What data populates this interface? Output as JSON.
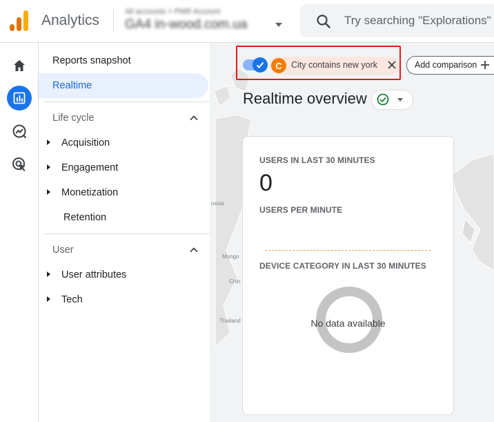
{
  "header": {
    "app_name": "Analytics",
    "account_name": "All accounts > PMR Account",
    "property_name": "GA4 in-wood.com.ua",
    "search_placeholder": "Try searching \"Explorations\""
  },
  "nav": {
    "items": [
      {
        "label": "Reports snapshot"
      },
      {
        "label": "Realtime"
      }
    ],
    "sections": [
      {
        "title": "Life cycle",
        "items": [
          "Acquisition",
          "Engagement",
          "Monetization",
          "Retention"
        ]
      },
      {
        "title": "User",
        "items": [
          "User attributes",
          "Tech"
        ]
      }
    ]
  },
  "comparison": {
    "avatar_letter": "C",
    "chip_text": "City contains new york",
    "add_label": "Add comparison"
  },
  "main": {
    "title": "Realtime overview"
  },
  "map_labels": [
    "ussia",
    "Mongo",
    "Chin",
    "Thailand"
  ],
  "card": {
    "users_label": "USERS IN LAST 30 MINUTES",
    "users_value": "0",
    "per_minute_label": "USERS PER MINUTE",
    "device_label": "DEVICE CATEGORY IN LAST 30 MINUTES",
    "no_data": "No data available"
  },
  "colors": {
    "accent": "#1a73e8",
    "active_nav_bg": "#e8f0fe",
    "highlight_border": "#e31b1b",
    "chip_bg": "#fde7e0",
    "avatar": "#f57c00",
    "sparkline": "#e8a33d",
    "donut_empty": "#c4c4c4"
  },
  "icons": {
    "logo": "analytics-logo-icon",
    "search": "search-icon",
    "rail": [
      "home-icon",
      "reports-icon",
      "explore-icon",
      "advertising-icon"
    ]
  }
}
